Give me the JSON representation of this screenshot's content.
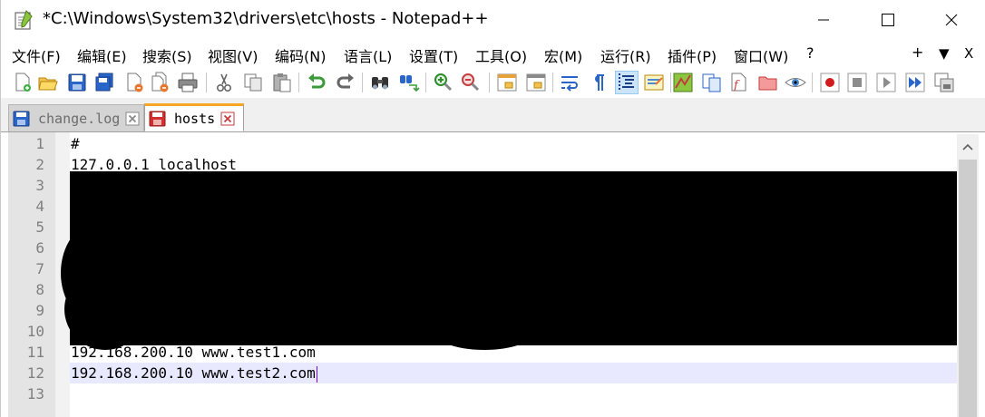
{
  "window": {
    "title": "*C:\\Windows\\System32\\drivers\\etc\\hosts - Notepad++"
  },
  "menu": {
    "items": [
      {
        "label": "文件(F)"
      },
      {
        "label": "编辑(E)"
      },
      {
        "label": "搜索(S)"
      },
      {
        "label": "视图(V)"
      },
      {
        "label": "编码(N)"
      },
      {
        "label": "语言(L)"
      },
      {
        "label": "设置(T)"
      },
      {
        "label": "工具(O)"
      },
      {
        "label": "宏(M)"
      },
      {
        "label": "运行(R)"
      },
      {
        "label": "插件(P)"
      },
      {
        "label": "窗口(W)"
      },
      {
        "label": "?"
      }
    ],
    "right": {
      "plus": "+",
      "down": "▼",
      "close": "X"
    }
  },
  "tabs": [
    {
      "label": "change.log",
      "state": "inactive"
    },
    {
      "label": "hosts",
      "state": "active"
    }
  ],
  "editor": {
    "line_numbers": [
      "1",
      "2",
      "3",
      "4",
      "5",
      "6",
      "7",
      "8",
      "9",
      "10",
      "11",
      "12",
      "13"
    ],
    "lines": [
      "#",
      "127.0.0.1 localhost",
      "",
      "",
      "",
      "",
      "",
      "",
      "",
      "",
      "192.168.200.10 www.test1.com",
      "192.168.200.10 www.test2.com",
      ""
    ],
    "current_line": 12
  },
  "colors": {
    "tab_accent": "#f5a623",
    "current_line_bg": "#e8e8ff",
    "caret": "#7f00ff",
    "gutter_bg": "#e4e4e4"
  }
}
